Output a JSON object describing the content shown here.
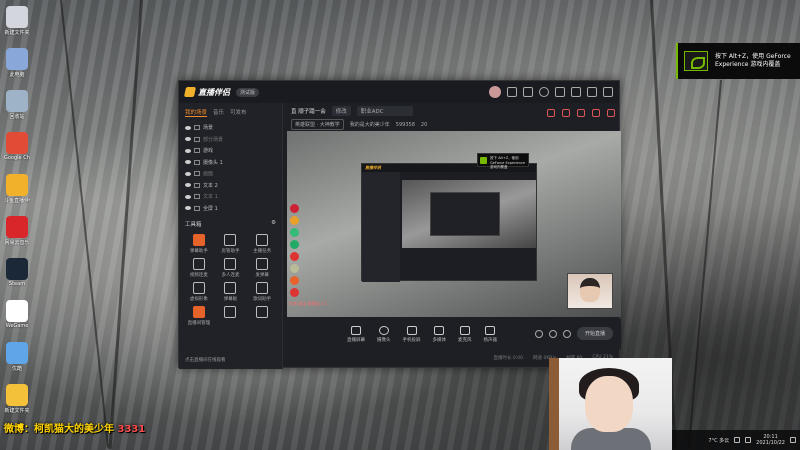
{
  "desktop": {
    "icons": [
      {
        "label": "新建文件夹",
        "color": "#d3d6dc"
      },
      {
        "label": "此电脑",
        "color": "#8aa7d9"
      },
      {
        "label": "回收站",
        "color": "#9eb3c8"
      },
      {
        "label": "Google Chrome",
        "color": "#e24b35"
      },
      {
        "label": "斗鱼直播伴侣",
        "color": "#f2b12b"
      },
      {
        "label": "网易云音乐",
        "color": "#d9262b"
      },
      {
        "label": "Steam",
        "color": "#1b2838"
      },
      {
        "label": "WeGame",
        "color": "#ffffff"
      },
      {
        "label": "优酷",
        "color": "#5fa6e8"
      },
      {
        "label": "新建文件夹",
        "color": "#f3c13a"
      }
    ]
  },
  "app": {
    "name": "直播伴侣",
    "version_badge": "测试版",
    "left_tabs": [
      "我的场景",
      "音乐",
      "可发布"
    ],
    "scenes": [
      {
        "label": "场景",
        "dim": false
      },
      {
        "label": "部分场景",
        "dim": true
      },
      {
        "label": "游戏",
        "dim": false
      },
      {
        "label": "摄像头 1",
        "dim": false
      },
      {
        "label": "画面",
        "dim": true
      },
      {
        "label": "文本 2",
        "dim": false
      },
      {
        "label": "文本 1",
        "dim": true
      },
      {
        "label": "全屏 1",
        "dim": false
      }
    ],
    "tools_title": "工具箱",
    "tools": [
      {
        "label": "弹幕助手",
        "style": "orange"
      },
      {
        "label": "房管助手",
        "style": ""
      },
      {
        "label": "主播任务",
        "style": ""
      },
      {
        "label": "视频连麦",
        "style": ""
      },
      {
        "label": "多人连麦",
        "style": ""
      },
      {
        "label": "发弹幕",
        "style": ""
      },
      {
        "label": "虚拟形象",
        "style": ""
      },
      {
        "label": "弹幕板",
        "style": ""
      },
      {
        "label": "歌词助手",
        "style": ""
      },
      {
        "label": "直播间管理",
        "style": "orange"
      },
      {
        "label": "",
        "style": ""
      },
      {
        "label": "",
        "style": ""
      }
    ],
    "left_footer": "点击直播间在线观看",
    "info": {
      "room_title": "直 顺子踏一会",
      "edit_label": "修改",
      "category": "职业ADC",
      "tag1": "英雄联盟 · 大神教学",
      "streamer": "我的是大的美少年",
      "room_id": "599358",
      "fans": "20"
    },
    "bottom_tools": [
      {
        "label": "直播屏幕"
      },
      {
        "label": "摄像头"
      },
      {
        "label": "手机投屏"
      },
      {
        "label": "多媒体"
      },
      {
        "label": "麦克风"
      },
      {
        "label": "扬声器"
      }
    ],
    "start_label": "开始直播",
    "status": [
      "直播时长 0:00",
      "网速 0KB/s",
      "帧率 60",
      "CPU 21%"
    ],
    "gift_line": "礼物 送出 萌萌哒 x 1"
  },
  "nvidia_toast": {
    "line1": "按下 Alt+Z，使用 GeForce",
    "line2": "Experience 游戏内覆盖"
  },
  "nested_nvidia": "按下 Alt+Z，使用 GeForce Experience 游戏内覆盖",
  "banner": {
    "text": "微博：柯凯猫大的美少年",
    "num": "3331"
  },
  "tray": {
    "weather": "7°C 多云",
    "time": "20:11",
    "date": "2021/10/22"
  }
}
